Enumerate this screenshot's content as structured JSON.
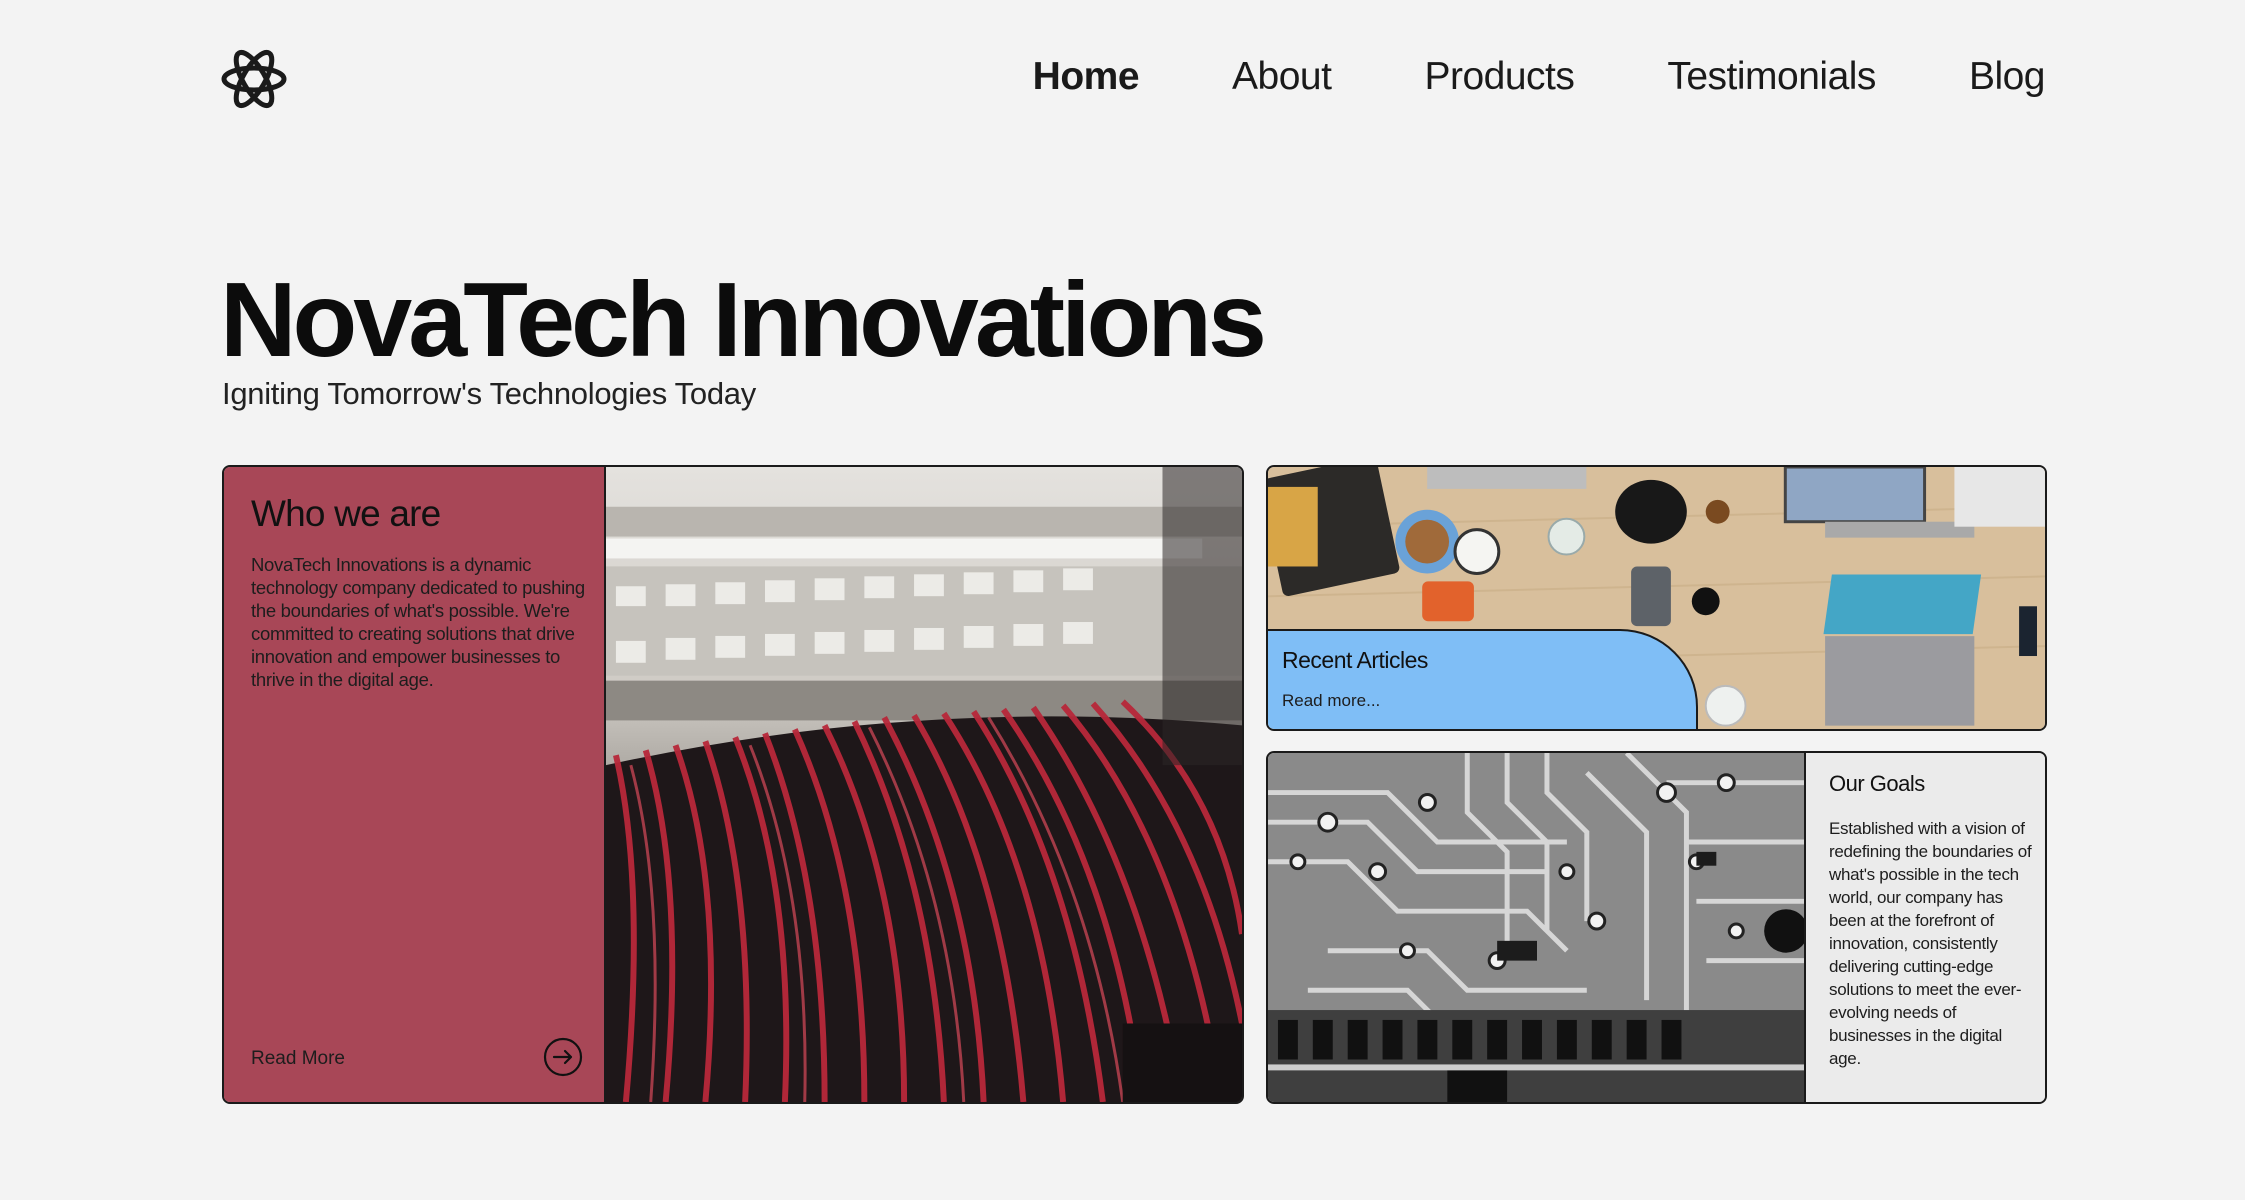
{
  "header": {
    "logo_icon": "atom-icon",
    "nav": [
      {
        "label": "Home",
        "active": true
      },
      {
        "label": "About"
      },
      {
        "label": "Products"
      },
      {
        "label": "Testimonials"
      },
      {
        "label": "Blog"
      }
    ]
  },
  "hero": {
    "title": "NovaTech Innovations",
    "subtitle": "Igniting Tomorrow's Technologies Today"
  },
  "who_card": {
    "title": "Who we are",
    "text": "NovaTech Innovations is a dynamic technology company dedicated to pushing the boundaries of what's possible. We're committed to creating solutions that drive innovation and empower businesses to thrive in the digital age.",
    "read_more": "Read More",
    "arrow_icon": "arrow-right-circle-icon",
    "panel_color": "#a84757",
    "photo": "network patch panel with red cables"
  },
  "articles_card": {
    "title": "Recent Articles",
    "read_more": "Read more...",
    "tab_color": "#7fbef6",
    "photo": "top-down desk with laptops"
  },
  "goals_card": {
    "title": "Our Goals",
    "text": "Established with a vision of redefining the boundaries of what's possible in the tech world, our company has been at the forefront of innovation, consistently delivering cutting-edge solutions to meet the ever-evolving needs of businesses in the digital age.",
    "photo": "grayscale circuit board"
  }
}
